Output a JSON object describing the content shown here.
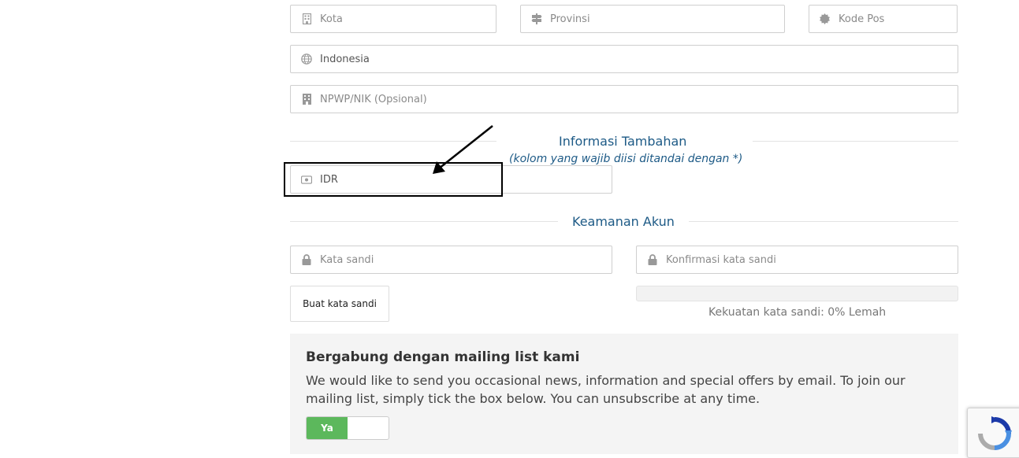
{
  "address": {
    "city_placeholder": "Kota",
    "province_placeholder": "Provinsi",
    "postcode_placeholder": "Kode Pos",
    "country_value": "Indonesia",
    "tax_placeholder": "NPWP/NIK (Opsional)"
  },
  "additional": {
    "title": "Informasi Tambahan",
    "subtitle": "(kolom yang wajib diisi ditandai dengan *)",
    "currency_value": "IDR"
  },
  "security": {
    "title": "Keamanan Akun",
    "password_placeholder": "Kata sandi",
    "confirm_placeholder": "Konfirmasi kata sandi",
    "generate_label": "Buat kata sandi",
    "strength_text": "Kekuatan kata sandi: 0% Lemah",
    "strength_percent": 0
  },
  "mailing": {
    "title": "Bergabung dengan mailing list kami",
    "text": "We would like to send you occasional news, information and special offers by email. To join our mailing list, simply tick the box below. You can unsubscribe at any time.",
    "toggle_label": "Ya",
    "toggle_on": true
  },
  "colors": {
    "accent": "#1d5a86",
    "toggle_on": "#5cb85c"
  },
  "icons": [
    "building-icon",
    "signpost-icon",
    "certificate-icon",
    "globe-icon",
    "office-icon",
    "money-icon",
    "lock-icon",
    "recaptcha-icon",
    "arrow-annotation"
  ]
}
